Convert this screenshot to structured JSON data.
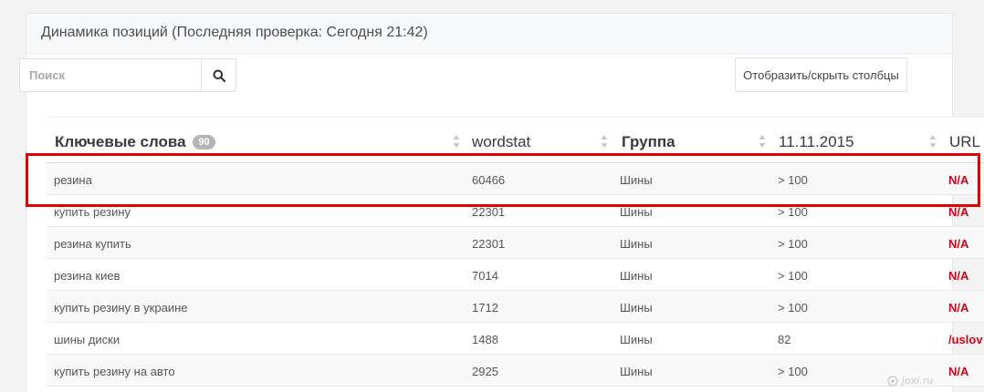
{
  "panel": {
    "title": "Динамика позиций (Последняя проверка: Сегодня 21:42)"
  },
  "search": {
    "placeholder": "Поиск"
  },
  "toolbar": {
    "columns_toggle_label": "Отобразить/скрыть столбцы"
  },
  "table": {
    "headers": {
      "keywords": "Ключевые слова",
      "keywords_count": "90",
      "wordstat": "wordstat",
      "group": "Группа",
      "date": "11.11.2015",
      "url": "URL"
    },
    "rows": [
      {
        "keyword": "резина",
        "wordstat": "60466",
        "group": "Шины",
        "position": "> 100",
        "url": "N/A"
      },
      {
        "keyword": "купить резину",
        "wordstat": "22301",
        "group": "Шины",
        "position": "> 100",
        "url": "N/A"
      },
      {
        "keyword": "резина купить",
        "wordstat": "22301",
        "group": "Шины",
        "position": "> 100",
        "url": "N/A"
      },
      {
        "keyword": "резина киев",
        "wordstat": "7014",
        "group": "Шины",
        "position": "> 100",
        "url": "N/A"
      },
      {
        "keyword": "купить резину в украине",
        "wordstat": "1712",
        "group": "Шины",
        "position": "> 100",
        "url": "N/A"
      },
      {
        "keyword": "шины диски",
        "wordstat": "1488",
        "group": "Шины",
        "position": "82",
        "url": "/uslov"
      },
      {
        "keyword": "купить резину на авто",
        "wordstat": "2925",
        "group": "Шины",
        "position": "> 100",
        "url": "N/A"
      }
    ]
  },
  "watermark": {
    "text": "joxi.ru"
  },
  "colors": {
    "accent_red": "#d9001a",
    "highlight_border": "#e00000"
  }
}
